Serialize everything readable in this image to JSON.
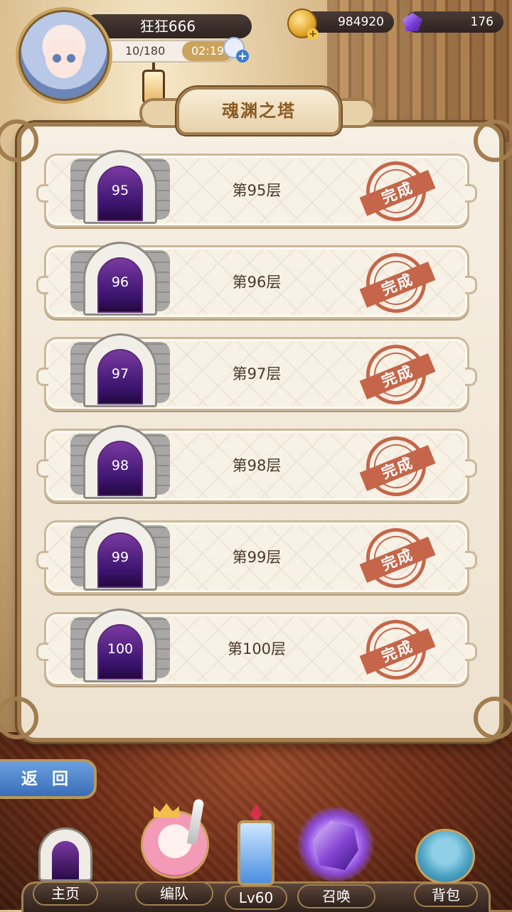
{
  "player": {
    "name": "狂狂666",
    "energy": "10/180",
    "energy_timer": "02:19"
  },
  "currency": {
    "gold": "984920",
    "gems": "176"
  },
  "panel": {
    "title": "魂渊之塔"
  },
  "floors": [
    {
      "number": "95",
      "label": "第95层",
      "status": "完成"
    },
    {
      "number": "96",
      "label": "第96层",
      "status": "完成"
    },
    {
      "number": "97",
      "label": "第97层",
      "status": "完成"
    },
    {
      "number": "98",
      "label": "第98层",
      "status": "完成"
    },
    {
      "number": "99",
      "label": "第99层",
      "status": "完成"
    },
    {
      "number": "100",
      "label": "第100层",
      "status": "完成"
    }
  ],
  "back_button": {
    "label": "返 回"
  },
  "nav": {
    "home": "主页",
    "team": "编队",
    "level": "Lv60",
    "summon": "召唤",
    "bag": "背包"
  },
  "colors": {
    "stamp_red": "#c0583a",
    "panel_border": "#a17d4f",
    "back_blue": "#3a6fb8",
    "door_purple": "#3c1570"
  }
}
